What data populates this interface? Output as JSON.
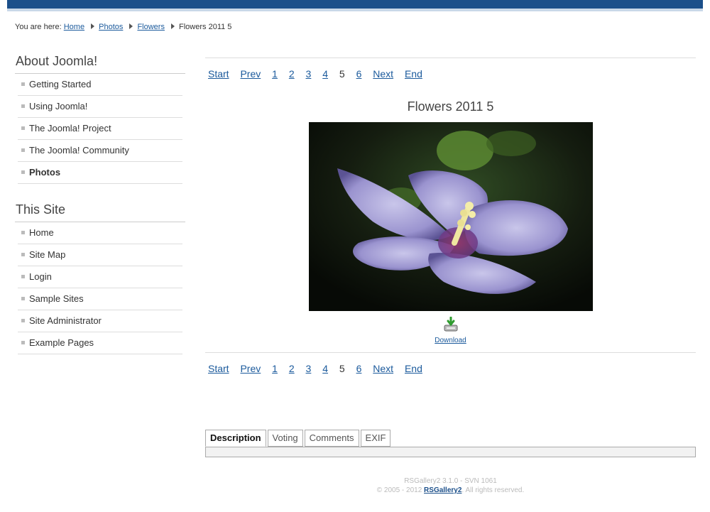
{
  "breadcrumb": {
    "prefix": "You are here:",
    "links": [
      "Home",
      "Photos",
      "Flowers"
    ],
    "current": "Flowers 2011 5"
  },
  "sidebar": {
    "about": {
      "title": "About Joomla!",
      "items": [
        "Getting Started",
        "Using Joomla!",
        "The Joomla! Project",
        "The Joomla! Community",
        "Photos"
      ],
      "active": "Photos"
    },
    "site": {
      "title": "This Site",
      "items": [
        "Home",
        "Site Map",
        "Login",
        "Sample Sites",
        "Site Administrator",
        "Example Pages"
      ]
    }
  },
  "pager": {
    "start": "Start",
    "prev": "Prev",
    "pages": [
      "1",
      "2",
      "3",
      "4",
      "5",
      "6"
    ],
    "current": "5",
    "next": "Next",
    "end": "End"
  },
  "photo": {
    "title": "Flowers 2011 5",
    "download_label": "Download",
    "download_icon": "download-icon"
  },
  "tabs": {
    "items": [
      "Description",
      "Voting",
      "Comments",
      "EXIF"
    ],
    "active": "Description"
  },
  "footer": {
    "version": "RSGallery2 3.1.0 - SVN 1061",
    "copyright_prefix": "© 2005 - 2012",
    "link": "RSGallery2",
    "rights": "All rights reserved."
  },
  "colors": {
    "brand_bar": "#1b4f8a",
    "link": "#1b5a9c"
  }
}
